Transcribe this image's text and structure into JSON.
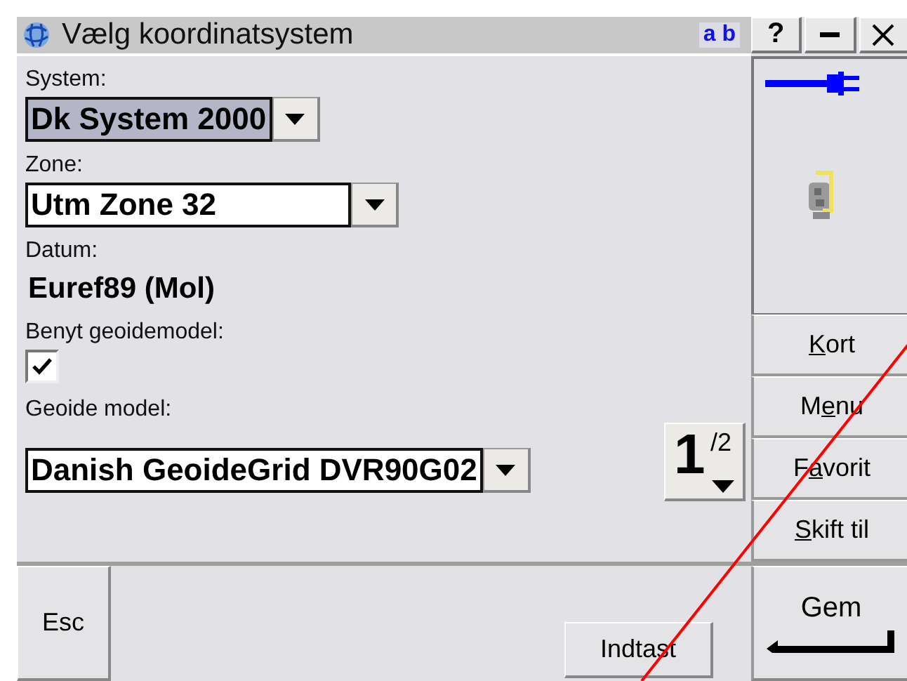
{
  "window": {
    "title": "Vælg koordinatsystem",
    "input_mode": "a b",
    "header_buttons": [
      {
        "kind": "help",
        "label": "?"
      },
      {
        "kind": "minimize"
      },
      {
        "kind": "close"
      }
    ]
  },
  "fields": [
    {
      "kind": "dropdown",
      "label": "System:",
      "value": "Dk System 2000",
      "focused": true
    },
    {
      "kind": "dropdown",
      "label": "Zone:",
      "value": "Utm Zone 32",
      "focused": false
    },
    {
      "kind": "readonly",
      "label": "Datum:",
      "value": "Euref89 (Mol)"
    },
    {
      "kind": "checkbox",
      "label": "Benyt geoidemodel:",
      "checked": true
    },
    {
      "kind": "dropdown",
      "label": "Geoide model:",
      "value": "Danish GeoideGrid DVR90G02",
      "focused": false
    }
  ],
  "page_indicator": {
    "current": "1",
    "total": "/2"
  },
  "side_buttons": [
    {
      "key": "K",
      "after": "ort"
    },
    {
      "before": "M",
      "key": "e",
      "after": "nu"
    },
    {
      "before": "F",
      "key": "a",
      "after": "vorit"
    },
    {
      "key": "S",
      "after": "kift til"
    }
  ],
  "bottom_buttons": [
    {
      "kind": "esc",
      "label": "Esc"
    },
    {
      "kind": "plain",
      "label": "Indtast"
    },
    {
      "kind": "enter",
      "label": "Gem"
    }
  ]
}
